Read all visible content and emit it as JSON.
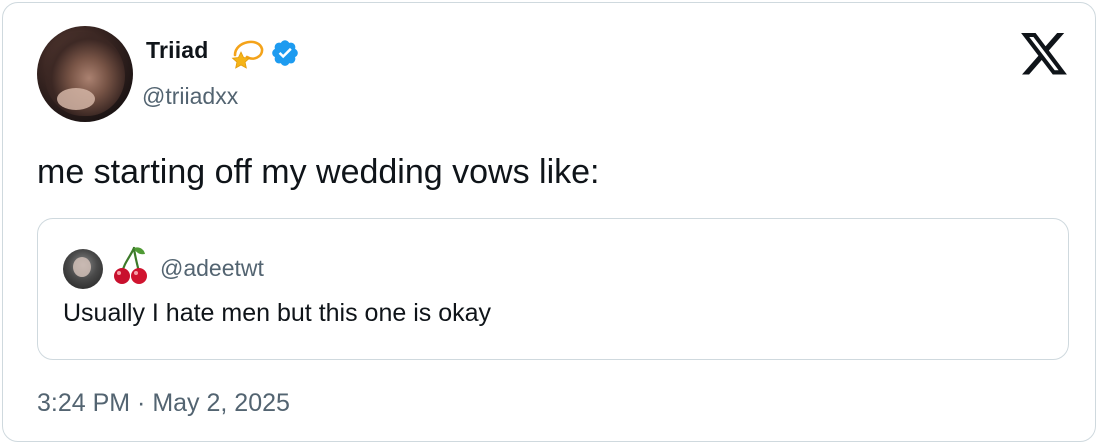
{
  "author": {
    "display_name": "Triiad",
    "name_emoji": "dizzy-star-emoji",
    "verified": true,
    "handle": "@triiadxx"
  },
  "tweet": {
    "text": "me starting off my wedding vows like:"
  },
  "quoted_tweet": {
    "emoji": "cherries-emoji",
    "handle": "@adeetwt",
    "text": "Usually I hate men but this one is okay"
  },
  "timestamp": "3:24 PM · May 2, 2025",
  "brand": {
    "logo": "x-logo-icon",
    "verified_color": "#1d9bf0",
    "secondary_text_color": "#536471",
    "border_color": "#cfd9de"
  }
}
